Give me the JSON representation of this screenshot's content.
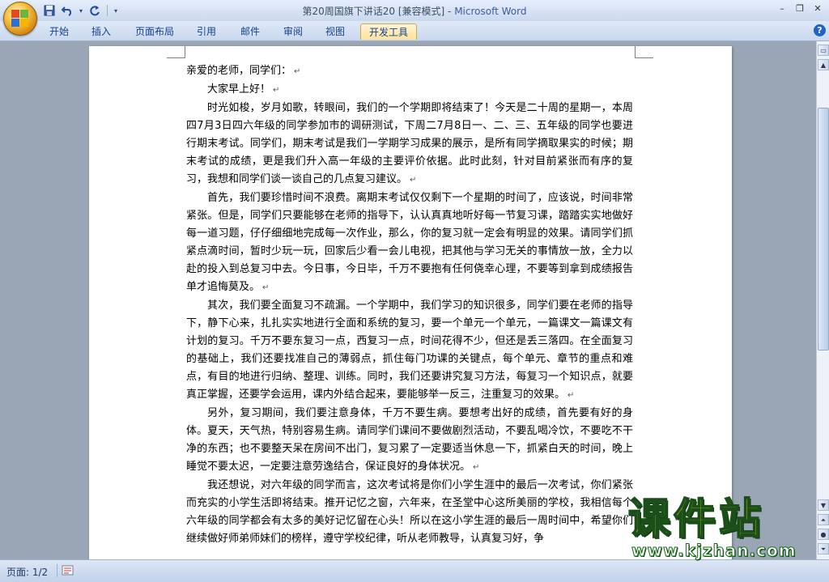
{
  "window": {
    "title": "第20周国旗下讲话20 [兼容模式]",
    "title_sep": " - ",
    "app_name": "Microsoft Word"
  },
  "ribbon": {
    "tabs": [
      {
        "label": "开始"
      },
      {
        "label": "插入"
      },
      {
        "label": "页面布局"
      },
      {
        "label": "引用"
      },
      {
        "label": "邮件"
      },
      {
        "label": "审阅"
      },
      {
        "label": "视图"
      },
      {
        "label": "开发工具"
      }
    ],
    "active_tab": "开发工具"
  },
  "document": {
    "paragraphs": [
      "亲爱的老师，同学们：",
      "大家早上好！",
      "时光如梭，岁月如歌，转眼间，我们的一个学期即将结束了！今天是二十周的星期一，本周四7月3日四六年级的同学参加市的调研测试，下周二7月8日一、二、三、五年级的同学也要进行期末考试。同学们，期末考试是我们一学期学习成果的展示，是所有同学摘取果实的时候；期末考试的成绩，更是我们升入高一年级的主要评价依据。此时此刻，针对目前紧张而有序的复习，我想和同学们谈一谈自己的几点复习建议。",
      "首先，我们要珍惜时间不浪费。离期末考试仅仅剩下一个星期的时间了，应该说，时间非常紧张。但是，同学们只要能够在老师的指导下，认认真真地听好每一节复习课，踏踏实实地做好每一道习题，仔仔细细地完成每一次作业，那么，你的复习就一定会有明显的效果。请同学们抓紧点滴时间，暂时少玩一玩，回家后少看一会儿电视，把其他与学习无关的事情放一放，全力以赴的投入到总复习中去。今日事，今日毕，千万不要抱有任何侥幸心理，不要等到拿到成绩报告单才追悔莫及。",
      "其次，我们要全面复习不疏漏。一个学期中，我们学习的知识很多，同学们要在老师的指导下，静下心来，扎扎实实地进行全面和系统的复习，要一个单元一个单元，一篇课文一篇课文有计划的复习。千万不要东复习一点，西复习一点，时间花得不少，但还是丢三落四。在全面复习的基础上，我们还要找准自己的薄弱点，抓住每门功课的关键点，每个单元、章节的重点和难点，有目的地进行归纳、整理、训练。同时，我们还要讲究复习方法，每复习一个知识点，就要真正掌握，还要学会运用，课内外结合起来，要能够举一反三，注重复习的效果。",
      "另外，复习期间，我们要注意身体，千万不要生病。要想考出好的成绩，首先要有好的身体。夏天，天气热，特别容易生病。请同学们课间不要做剧烈活动，不要乱喝冷饮，不要吃不干净的东西；也不要整天呆在房间不出门，复习累了一定要适当休息一下，抓紧白天的时间，晚上睡觉不要太迟，一定要注意劳逸结合，保证良好的身体状况。",
      "我还想说，对六年级的同学而言，这次考试将是你们小学生涯中的最后一次考试，你们紧张而充实的小学生活即将结束。推开记忆之窗，六年来，在圣堂中心这所美丽的学校，我相信每个六年级的同学都会有太多的美好记忆留在心头！所以在这小学生涯的最后一周时间中，希望你们继续做好师弟师妹们的榜样，遵守学校纪律，听从老师教导，认真复习好，争"
    ],
    "paragraph_mark": "↵"
  },
  "statusbar": {
    "page_label": "页面: 1/2"
  },
  "watermark": {
    "title": "课件站",
    "url": "www.kjzhan.com"
  }
}
